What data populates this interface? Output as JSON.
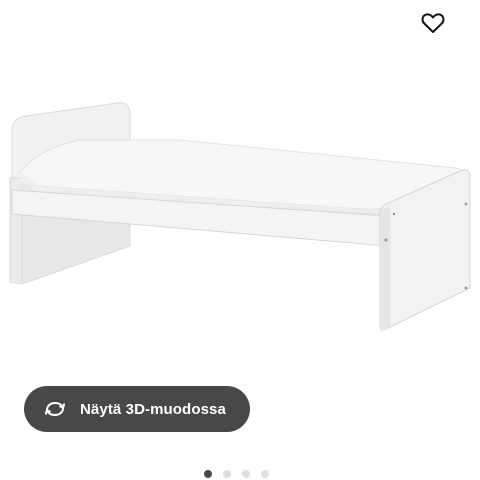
{
  "product": {
    "image_alt": "White single bed frame with mattress",
    "favourite_icon": "heart-outline-icon"
  },
  "view3d": {
    "label": "Näytä 3D-muodossa",
    "icon": "rotate-3d-icon"
  },
  "carousel": {
    "total": 4,
    "active_index": 0
  },
  "colors": {
    "button_bg": "#484848",
    "dot_active": "#484848",
    "dot_inactive": "#dfdfdf"
  }
}
